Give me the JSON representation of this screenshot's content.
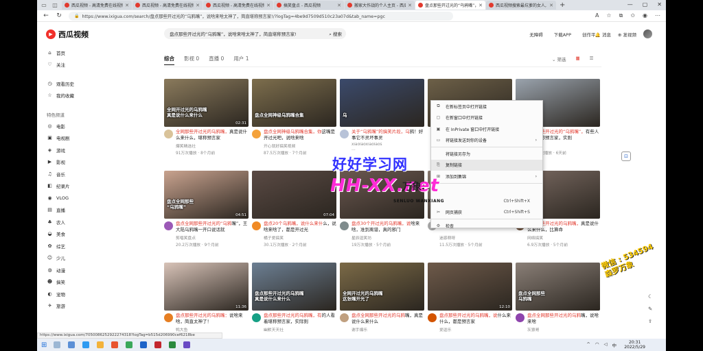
{
  "browser": {
    "tabs": [
      {
        "label": "西瓜视频 - 高清免费在线视频 -",
        "active": false
      },
      {
        "label": "西瓜视频 - 高清免费在线视频 -",
        "active": false
      },
      {
        "label": "西瓜视频 - 高清免费在线视频 -",
        "active": false
      },
      {
        "label": "搞笑盘点 - 西瓜视频",
        "active": false
      },
      {
        "label": "搬家大作战的个人主页 - 西瓜视",
        "active": false
      },
      {
        "label": "盘点那些开过光的“乌鸦嘴”，说",
        "active": true
      },
      {
        "label": "西瓜视频搜索最坑爹的女人, 男",
        "active": false
      }
    ],
    "url": "https://www.ixigua.com/search/盘点那些开过光的“乌鸦嘴”，说啥来啥太神了，简直堪称预言家!/?logTag=4be9d7509d510c23a07d&tab_name=pgc",
    "status_url": "https://www.ixigua.com/7050086252922274318?logTag=b515d206990cef6218be"
  },
  "site": {
    "logo_text": "西瓜视频",
    "search_query": "盘点那些开过光的“乌鸦嘴”，说啥来啥太神了，简直堪称预言家!",
    "search_button": "搜索",
    "header_links": [
      "无障碍",
      "下载APP",
      "创作平台"
    ],
    "messages": "消息",
    "publish": "发视频"
  },
  "sidebar": {
    "items_top": [
      {
        "label": "首页",
        "icon": "⌂"
      },
      {
        "label": "关注",
        "icon": "♡"
      }
    ],
    "items_mid": [
      {
        "label": "观看历史",
        "icon": "◷"
      },
      {
        "label": "我的收藏",
        "icon": "☆"
      }
    ],
    "section_title": "特色频道",
    "channels": [
      {
        "label": "电影",
        "icon": "◎"
      },
      {
        "label": "电视剧",
        "icon": "▣"
      },
      {
        "label": "游戏",
        "icon": "◈"
      },
      {
        "label": "影视",
        "icon": "▶"
      },
      {
        "label": "音乐",
        "icon": "♫"
      },
      {
        "label": "纪录片",
        "icon": "◧"
      },
      {
        "label": "VLOG",
        "icon": "◉"
      },
      {
        "label": "直播",
        "icon": "▤"
      },
      {
        "label": "农人",
        "icon": "♣"
      },
      {
        "label": "美食",
        "icon": "◒"
      },
      {
        "label": "综艺",
        "icon": "✿"
      },
      {
        "label": "少儿",
        "icon": "☺"
      },
      {
        "label": "动漫",
        "icon": "◍"
      },
      {
        "label": "搞笑",
        "icon": "☻"
      },
      {
        "label": "宠物",
        "icon": "◐"
      },
      {
        "label": "旅游",
        "icon": "✈"
      }
    ]
  },
  "filters": {
    "tabs": [
      "综合",
      "影视 0",
      "直播 0",
      "用户 1"
    ],
    "active": 0,
    "right": "筛选"
  },
  "videos": [
    {
      "caption": "全网开过光的乌鸦嘴\n真是说什么来什么",
      "duration": "02:31",
      "title_hl": "全网那些开过光的乌鸦嘴，",
      "title": "真是说什么来什么，堪称预言家",
      "author": "爆笑精选社",
      "stats": "91万次播放 · 8个月前",
      "thumb": "#8a7a5c",
      "avatar": "#d9c39a"
    },
    {
      "caption": "盘点全网神级乌鸦嘴合集",
      "duration": "",
      "title_hl": "盘点全网神级乌鸦嘴合集，你",
      "title": "这嘴是开过光吧，说啥来啥",
      "author": "开心就好搞笑视频",
      "stats": "87.5万次播放 · 7个月前",
      "thumb": "#7d6e4d",
      "avatar": "#f4a23b"
    },
    {
      "caption": "乌",
      "duration": "",
      "title_hl": "关于“乌鸦嘴”的搞笑片段，乌",
      "title": "鸦！好事它不灵坏事灵",
      "author": "xiaolaoxiaolaos",
      "stats": "…",
      "thumb": "#3b4a6b",
      "avatar": "#b8c3d8"
    },
    {
      "caption": "",
      "duration": "",
      "title_hl": "",
      "title": "",
      "author": "",
      "stats": "",
      "thumb": "#6d6048",
      "avatar": "#ccc"
    },
    {
      "caption": "看瓜预言家",
      "duration": "",
      "title_hl": "盘点那些开过光的“乌鸦嘴”，",
      "title": "有些人真是堪称预言家，实则",
      "author": "爆笑星星",
      "stats": "50.2万次播放 · 6天前",
      "thumb": "#9aa3ad",
      "avatar": "#e0b100"
    },
    {
      "caption": "盘点全网那些\n“乌鸦嘴”",
      "duration": "04:51",
      "title_hl": "盘点全网那些开过光的“乌鸦",
      "title": "嘴”，王大陆乌鸦嘴一开口说话就",
      "author": "剪唱笑盘点",
      "stats": "20.2万次播放 · 9个月前",
      "thumb": "#c9a38f",
      "avatar": "#9b59b6"
    },
    {
      "caption": "",
      "duration": "07:04",
      "title_hl": "盘点20个乌鸦嘴，说什么来什",
      "title": "么，说啥来啥了，都是开过光",
      "author": "橘子爱搞笑",
      "stats": "30.1万次播放 · 2个月前",
      "thumb": "#5a4a44",
      "avatar": "#f08a24"
    },
    {
      "caption": "",
      "duration": "",
      "title_hl": "盘点30个开过光的乌鸦嘴，说",
      "title": "啥来啥，准到离谱，真的邪门",
      "author": "星辰逗笑坊",
      "stats": "19万次播放 · 5个月前",
      "thumb": "#6b5850",
      "avatar": "#7f8c8d"
    },
    {
      "caption": "",
      "duration": "",
      "title_hl": "",
      "title": "说什么来什么，人类倒霉",
      "author": "迷惑萌呀",
      "stats": "11.5万次播放 · 5个月前",
      "thumb": "#8c7c72",
      "avatar": "#aaa"
    },
    {
      "caption": "",
      "duration": "",
      "title_hl": "盘点那些开过光的乌鸦嘴，",
      "title": "真是说什么来什么，比算命",
      "author": "网络搞笑",
      "stats": "6.9万次播放 · 5个月前",
      "thumb": "#7a6a62",
      "avatar": "#6b4f3a"
    },
    {
      "caption": "",
      "duration": "11:36",
      "title_hl": "盘点那些开过光的乌鸦嘴：",
      "title": "说啥来啥，简直太神了！",
      "author": "鸭大鱼",
      "stats": "",
      "thumb": "#d8c3b8",
      "avatar": "#e67e22"
    },
    {
      "caption": "盘点那些开过光的乌鸦嘴\n真是说什么来什么",
      "duration": "",
      "title_hl": "盘点那些开过光的乌鸦嘴，有",
      "title": "的人看着堪称预言家，实际则",
      "author": "幽默天天社",
      "stats": "",
      "thumb": "#6c7f93",
      "avatar": "#16a085"
    },
    {
      "caption": "全网开过光的乌鸦嘴\n这张嘴开光了",
      "duration": "",
      "title_hl": "盘点全网那些开过光的乌鸦",
      "title": "嘴，真是说什么来什么",
      "author": "谢手爆乐",
      "stats": "",
      "thumb": "#7b6a47",
      "avatar": "#c0a080"
    },
    {
      "caption": "",
      "duration": "12:10",
      "title_hl": "盘点那些开过光的乌鸦嘴，说",
      "title": "什么来什么，都是预言家",
      "author": "爱逗乐",
      "stats": "",
      "thumb": "#6e5a4a",
      "avatar": "#d35400"
    },
    {
      "caption": "盘点全网那些\n乌鸦嘴",
      "duration": "",
      "title_hl": "盘点全网那些开过光的乌鸦",
      "title": "嘴，说啥来啥",
      "author": "灰狼哥",
      "stats": "",
      "thumb": "#8a7f77",
      "avatar": "#8e44ad"
    }
  ],
  "context_menu": {
    "items": [
      {
        "label": "在新标签页中打开链接",
        "icon": "⧉",
        "shortcut": "",
        "arrow": false
      },
      {
        "label": "在新窗口中打开链接",
        "icon": "▢",
        "shortcut": "",
        "arrow": false
      },
      {
        "label": "在 InPrivate 窗口中打开链接",
        "icon": "▣",
        "shortcut": "",
        "arrow": false
      },
      {
        "label": "将链接发送到你的设备",
        "icon": "▭",
        "shortcut": "",
        "arrow": true
      },
      {
        "label": "将链接另存为",
        "icon": "",
        "shortcut": "",
        "arrow": false
      },
      {
        "label": "复制链接",
        "icon": "⎘",
        "shortcut": "",
        "arrow": false
      },
      {
        "label": "添加到集锦",
        "icon": "⊞",
        "shortcut": "",
        "arrow": true
      },
      {
        "label": "",
        "icon": "",
        "shortcut": "",
        "arrow": false
      },
      {
        "label": "",
        "icon": "",
        "shortcut": "Ctrl+Shift+X",
        "arrow": false
      },
      {
        "label": "网页捕获",
        "icon": "✂",
        "shortcut": "Ctrl+Shift+S",
        "arrow": false
      },
      {
        "label": "检查",
        "icon": "⚙",
        "shortcut": "",
        "arrow": false
      }
    ]
  },
  "watermark": {
    "line1": "好好学习网",
    "line2": "HH-XX.net",
    "line3": "万象",
    "line3b": "SENLUO WANXIANG",
    "corner": "微信 : 534594\n森罗万象"
  },
  "taskbar": {
    "time": "20:31",
    "date": "2022/5/29",
    "lang": "中"
  },
  "colors": {
    "accent": "#e23a2e",
    "watermark_blue": "#3232ff",
    "watermark_pink": "#ff2bd6"
  }
}
